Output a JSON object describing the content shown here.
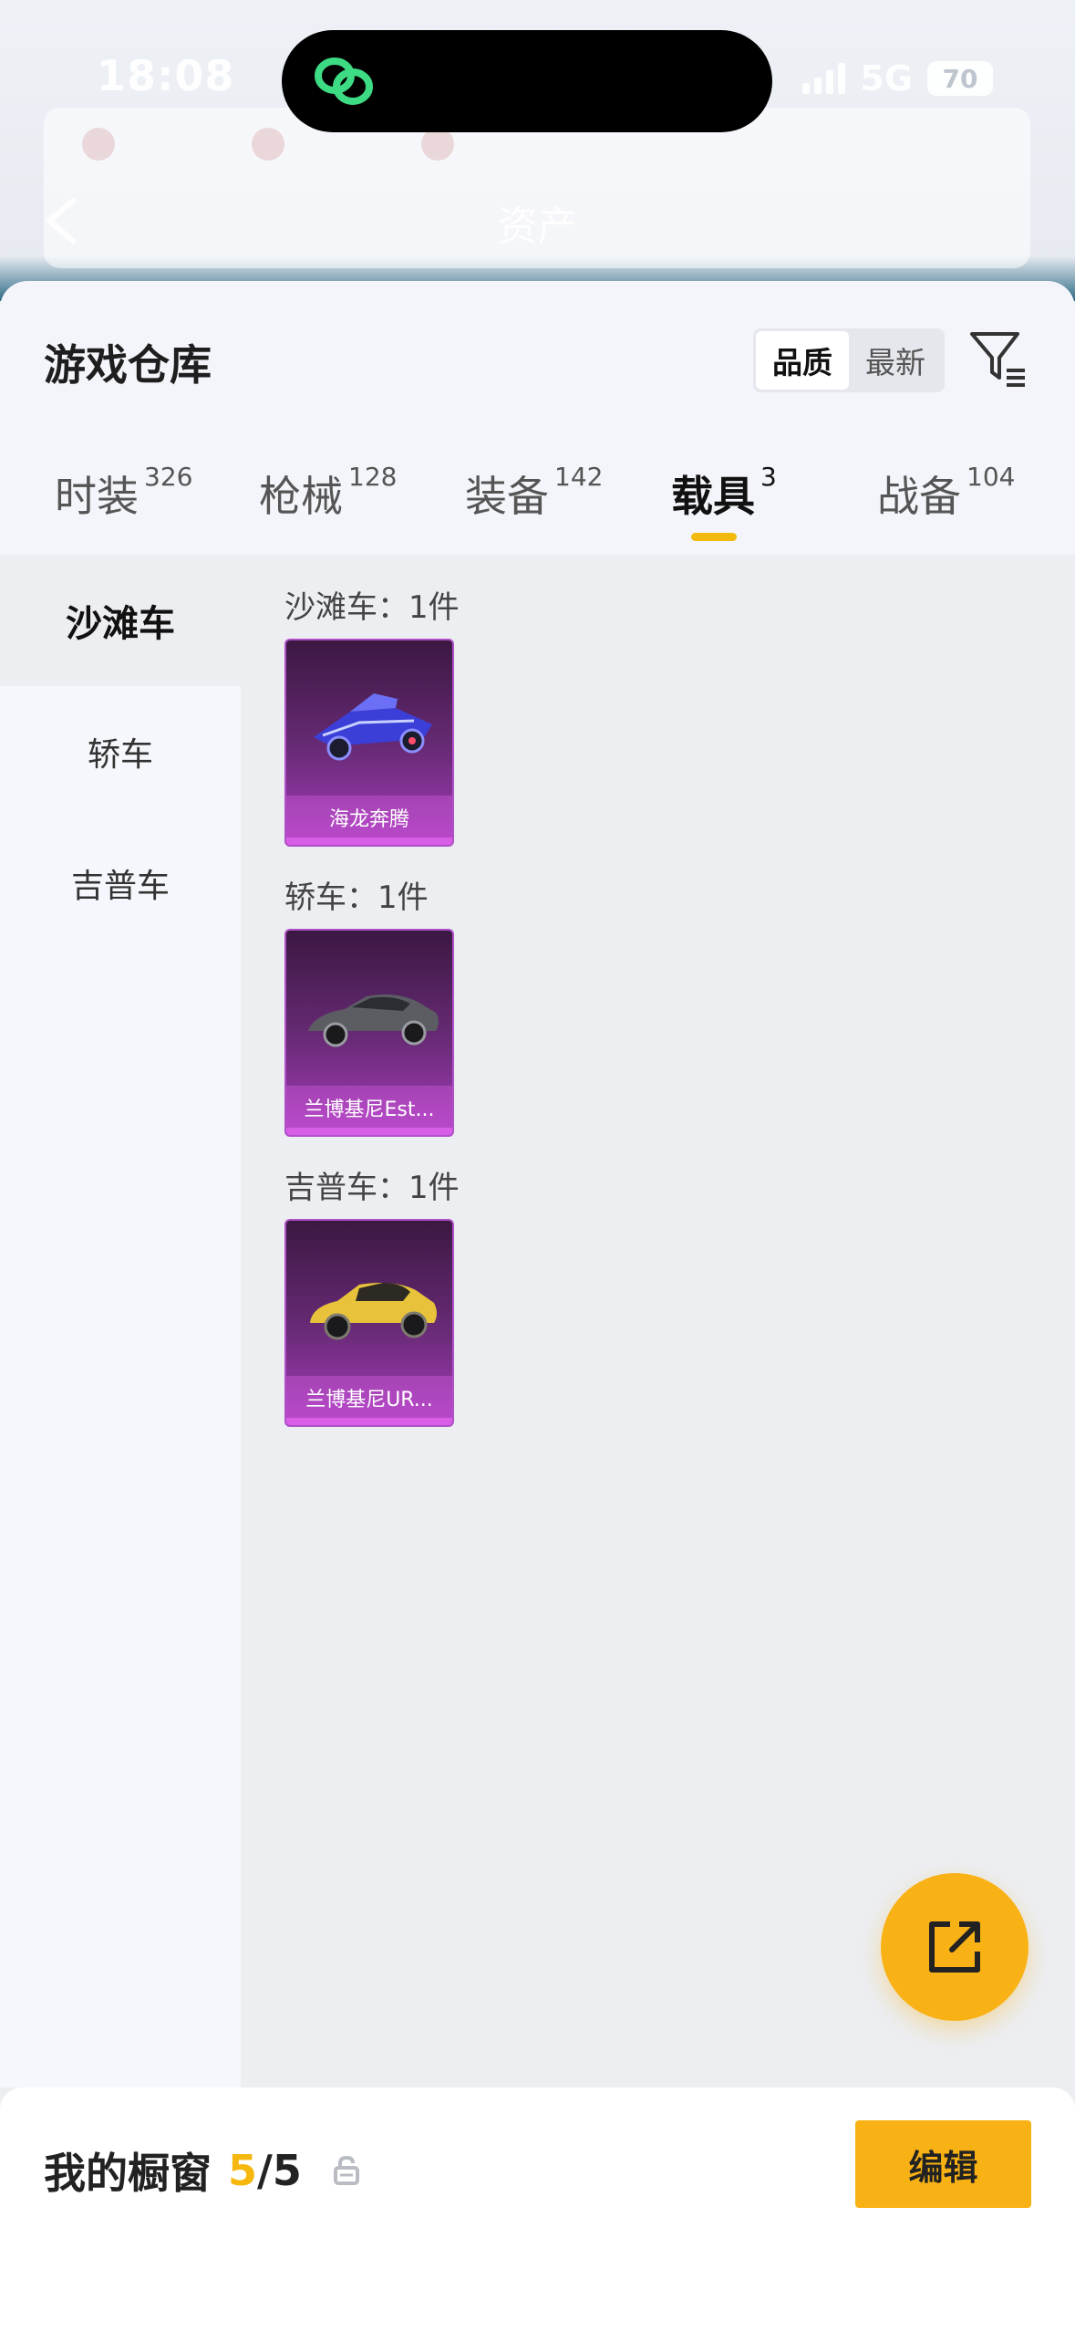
{
  "status_bar": {
    "time": "18:08",
    "network": "5G",
    "battery": "70"
  },
  "header": {
    "title": "资产"
  },
  "sheet": {
    "title": "游戏仓库",
    "sort_options": [
      "品质",
      "最新"
    ],
    "active_sort": "品质"
  },
  "tabs": [
    {
      "label": "时装",
      "count": "326"
    },
    {
      "label": "枪械",
      "count": "128"
    },
    {
      "label": "装备",
      "count": "142"
    },
    {
      "label": "载具",
      "count": "3"
    },
    {
      "label": "战备",
      "count": "104"
    }
  ],
  "active_tab": "载具",
  "categories": [
    "沙滩车",
    "轿车",
    "吉普车"
  ],
  "active_category": "沙滩车",
  "groups": [
    {
      "label": "沙滩车：1件",
      "items": [
        {
          "name": "海龙奔腾"
        }
      ]
    },
    {
      "label": "轿车：1件",
      "items": [
        {
          "name": "兰博基尼Est..."
        }
      ]
    },
    {
      "label": "吉普车：1件",
      "items": [
        {
          "name": "兰博基尼UR..."
        }
      ]
    }
  ],
  "showcase": {
    "label": "我的橱窗",
    "current": "5",
    "total": "/5"
  },
  "edit_label": "编辑",
  "colors": {
    "accent": "#f9b215",
    "card_purple": "#a83cbf"
  }
}
